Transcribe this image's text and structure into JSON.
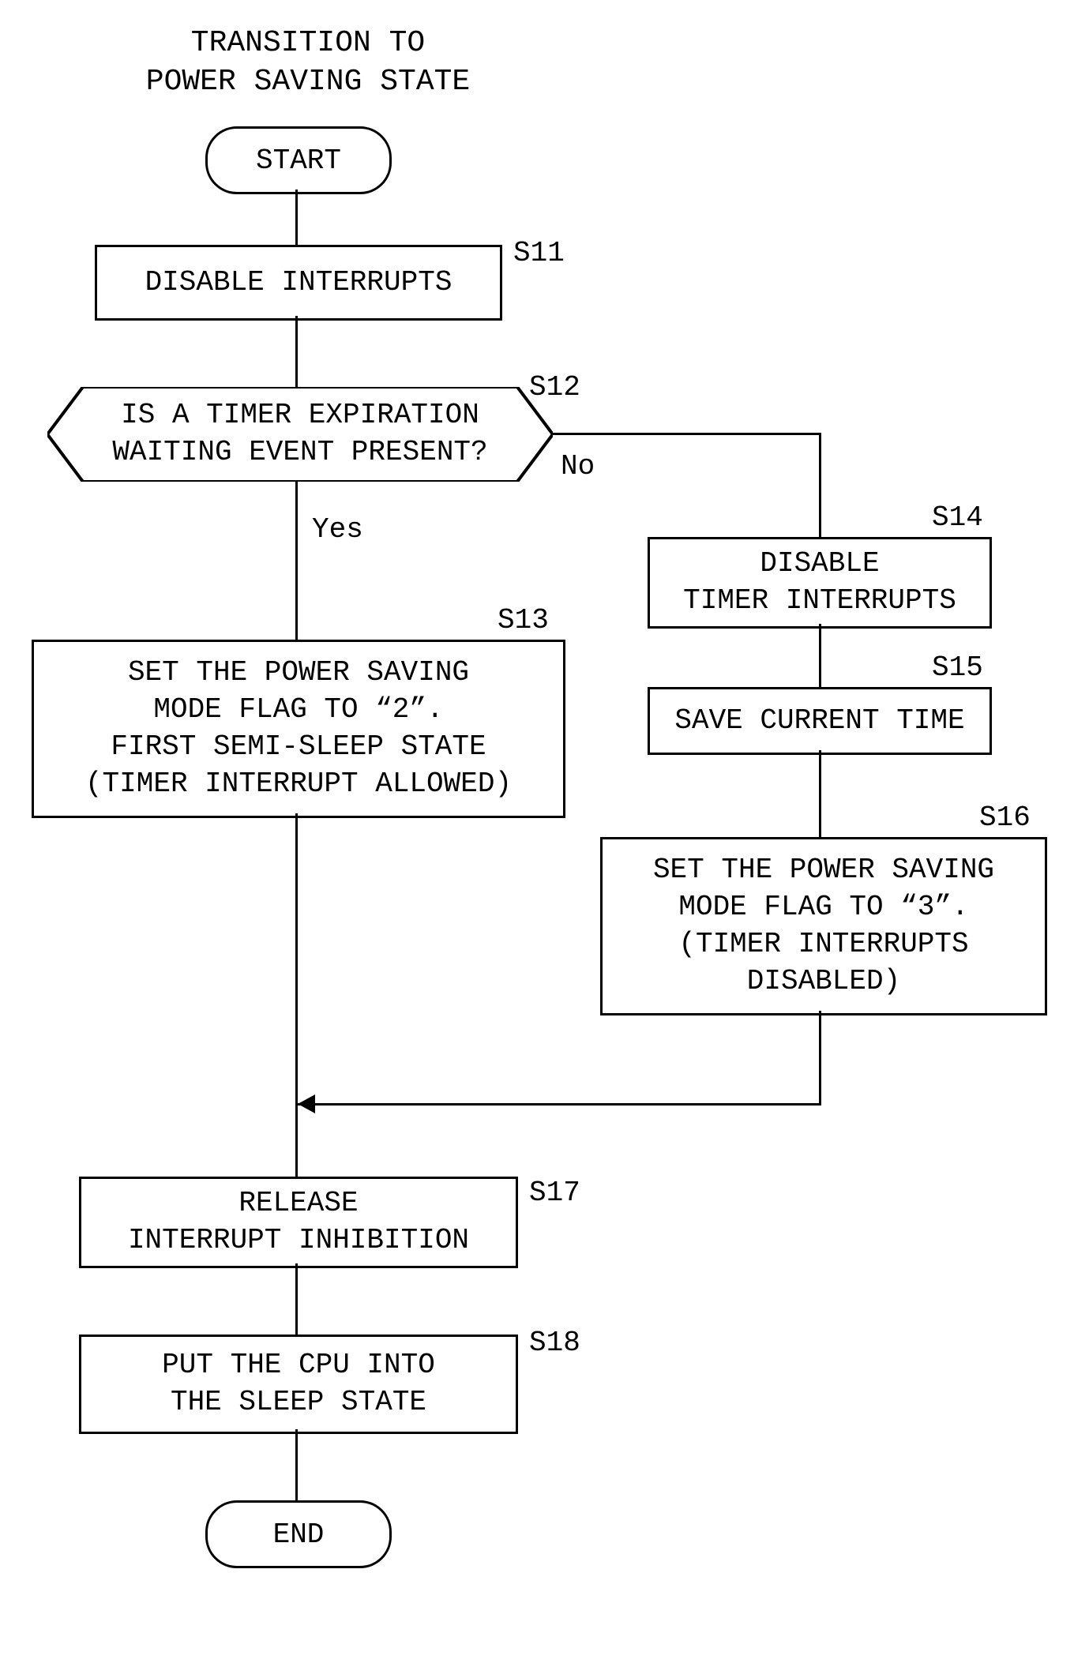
{
  "chart_data": {
    "type": "flowchart",
    "title": "TRANSITION TO\nPOWER SAVING STATE",
    "nodes": [
      {
        "id": "start",
        "kind": "terminator",
        "label": "START"
      },
      {
        "id": "s11",
        "kind": "process",
        "step": "S11",
        "label": "DISABLE INTERRUPTS"
      },
      {
        "id": "s12",
        "kind": "decision",
        "step": "S12",
        "label": "IS A TIMER EXPIRATION\nWAITING EVENT PRESENT?",
        "yes_to": "s13",
        "no_to": "s14"
      },
      {
        "id": "s13",
        "kind": "process",
        "step": "S13",
        "label": "SET THE POWER SAVING\nMODE FLAG TO “2”.\nFIRST SEMI-SLEEP STATE\n(TIMER INTERRUPT ALLOWED)"
      },
      {
        "id": "s14",
        "kind": "process",
        "step": "S14",
        "label": "DISABLE\nTIMER INTERRUPTS"
      },
      {
        "id": "s15",
        "kind": "process",
        "step": "S15",
        "label": "SAVE CURRENT TIME"
      },
      {
        "id": "s16",
        "kind": "process",
        "step": "S16",
        "label": "SET THE POWER SAVING\nMODE FLAG TO “3”.\n(TIMER INTERRUPTS\nDISABLED)"
      },
      {
        "id": "s17",
        "kind": "process",
        "step": "S17",
        "label": "RELEASE\nINTERRUPT INHIBITION"
      },
      {
        "id": "s18",
        "kind": "process",
        "step": "S18",
        "label": "PUT THE CPU INTO\nTHE SLEEP STATE"
      },
      {
        "id": "end",
        "kind": "terminator",
        "label": "END"
      }
    ],
    "edges": [
      {
        "from": "start",
        "to": "s11"
      },
      {
        "from": "s11",
        "to": "s12"
      },
      {
        "from": "s12",
        "to": "s13",
        "label": "Yes"
      },
      {
        "from": "s12",
        "to": "s14",
        "label": "No"
      },
      {
        "from": "s14",
        "to": "s15"
      },
      {
        "from": "s15",
        "to": "s16"
      },
      {
        "from": "s13",
        "to": "s17"
      },
      {
        "from": "s16",
        "to": "s17"
      },
      {
        "from": "s17",
        "to": "s18"
      },
      {
        "from": "s18",
        "to": "end"
      }
    ],
    "branch_labels": {
      "yes": "Yes",
      "no": "No"
    }
  }
}
